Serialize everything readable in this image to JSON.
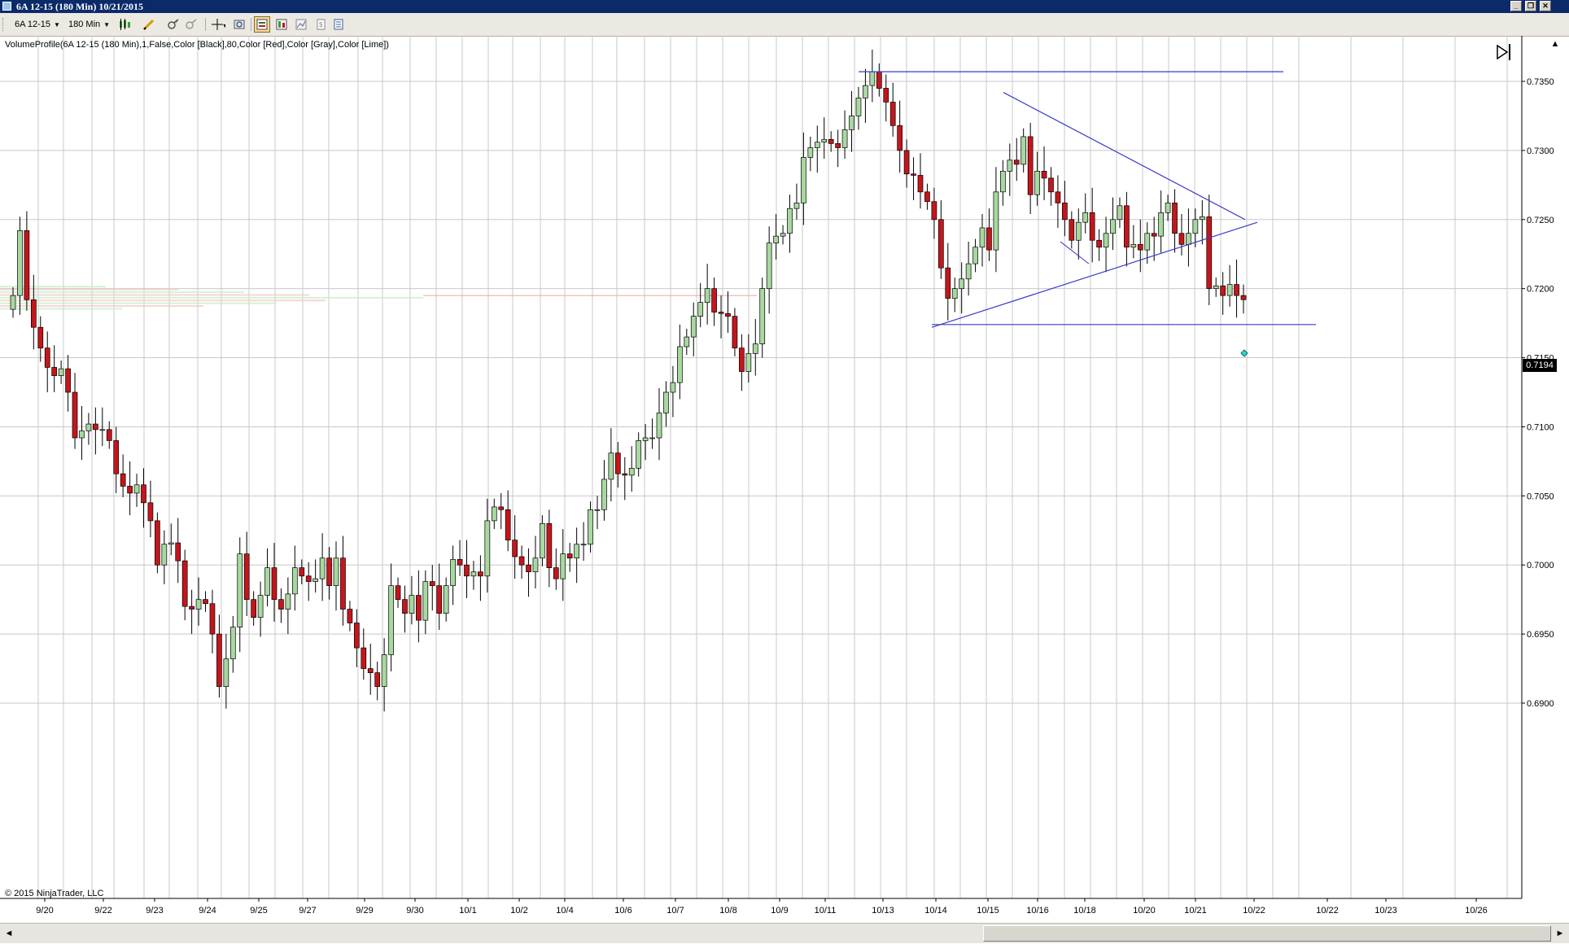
{
  "window": {
    "title": "6A 12-15 (180 Min)  10/21/2015",
    "controls": [
      "minimize-icon",
      "restore-icon",
      "close-icon"
    ]
  },
  "toolbar": {
    "instrument": "6A 12-15",
    "interval": "180 Min",
    "buttons": [
      "candlestick-icon",
      "pencil-icon",
      "zoom-in-icon",
      "zoom-out-icon",
      "crosshair-icon",
      "magnifier-icon",
      "chart-trader-icon",
      "data-box-icon",
      "chart-icon",
      "properties-icon",
      "template-icon"
    ]
  },
  "chart": {
    "indicator_label": "VolumeProfile(6A 12-15 (180 Min),1,False,Color [Black],80,Color [Red],Color [Gray],Color [Lime])",
    "copyright": "© 2015 NinjaTrader, LLC",
    "last_price": "0.7194",
    "colors": {
      "up": "#a8d8a0",
      "down": "#c4161c",
      "trendline": "#3a3acc",
      "grid": "#c8c8c8"
    }
  },
  "chart_data": {
    "type": "candlestick",
    "y_axis": {
      "range": [
        0.6887,
        0.7378
      ],
      "ticks": [
        "0.7350",
        "0.7300",
        "0.7250",
        "0.7200",
        "0.7150",
        "0.7100",
        "0.7050",
        "0.7000",
        "0.6950",
        "0.6900"
      ]
    },
    "x_axis": {
      "tick_labels": [
        "9/20",
        "9/22",
        "9/23",
        "9/24",
        "9/25",
        "9/27",
        "9/29",
        "9/30",
        "10/1",
        "10/2",
        "10/4",
        "10/6",
        "10/7",
        "10/8",
        "10/9",
        "10/11",
        "10/13",
        "10/14",
        "10/15",
        "10/16",
        "10/18",
        "10/20",
        "10/21",
        "10/22",
        "10/22",
        "10/23",
        "10/26"
      ]
    },
    "closes": [
      0.7195,
      0.7242,
      0.7192,
      0.7172,
      0.7157,
      0.7143,
      0.7137,
      0.7142,
      0.7125,
      0.7092,
      0.7097,
      0.7102,
      0.7098,
      0.7098,
      0.709,
      0.7066,
      0.7057,
      0.7052,
      0.7058,
      0.7045,
      0.7032,
      0.7,
      0.7015,
      0.7016,
      0.7003,
      0.697,
      0.6968,
      0.6975,
      0.6972,
      0.695,
      0.6912,
      0.6932,
      0.6955,
      0.7008,
      0.6975,
      0.6962,
      0.6978,
      0.6998,
      0.6975,
      0.6968,
      0.6979,
      0.6998,
      0.6992,
      0.6988,
      0.699,
      0.7005,
      0.6985,
      0.7005,
      0.6968,
      0.6958,
      0.694,
      0.6925,
      0.6922,
      0.6912,
      0.6935,
      0.6985,
      0.6975,
      0.6965,
      0.6978,
      0.696,
      0.6988,
      0.6985,
      0.6965,
      0.6985,
      0.7004,
      0.7,
      0.6992,
      0.6995,
      0.6992,
      0.7032,
      0.7042,
      0.704,
      0.7018,
      0.7006,
      0.7,
      0.6995,
      0.7005,
      0.703,
      0.6998,
      0.699,
      0.7008,
      0.7005,
      0.7015,
      0.7015,
      0.704,
      0.704,
      0.7062,
      0.7081,
      0.7066,
      0.7065,
      0.707,
      0.709,
      0.7092,
      0.7092,
      0.711,
      0.7125,
      0.7132,
      0.7158,
      0.7165,
      0.718,
      0.719,
      0.72,
      0.7183,
      0.7182,
      0.718,
      0.7157,
      0.714,
      0.7153,
      0.716,
      0.72,
      0.7233,
      0.7238,
      0.724,
      0.7258,
      0.7262,
      0.7295,
      0.7302,
      0.7306,
      0.7308,
      0.7305,
      0.7302,
      0.7315,
      0.7325,
      0.7338,
      0.7347,
      0.7357,
      0.7345,
      0.7335,
      0.7318,
      0.73,
      0.7283,
      0.7282,
      0.727,
      0.7263,
      0.725,
      0.7215,
      0.7193,
      0.72,
      0.7207,
      0.7218,
      0.723,
      0.7244,
      0.7228,
      0.727,
      0.7285,
      0.7293,
      0.729,
      0.731,
      0.7268,
      0.7285,
      0.728,
      0.727,
      0.7262,
      0.725,
      0.7235,
      0.7248,
      0.7255,
      0.7235,
      0.723,
      0.724,
      0.725,
      0.726,
      0.723,
      0.7232,
      0.7228,
      0.724,
      0.7238,
      0.7255,
      0.7262,
      0.724,
      0.7232,
      0.724,
      0.725,
      0.7252,
      0.72,
      0.7202,
      0.7195,
      0.7203,
      0.7195,
      0.7192
    ],
    "annotations": {
      "horizontal_lines": [
        0.7357,
        0.7174
      ],
      "triangle_upper": [
        [
          0.7342,
          0.725
        ]
      ],
      "triangle_lower": [
        [
          0.7172,
          0.7248
        ]
      ]
    }
  }
}
